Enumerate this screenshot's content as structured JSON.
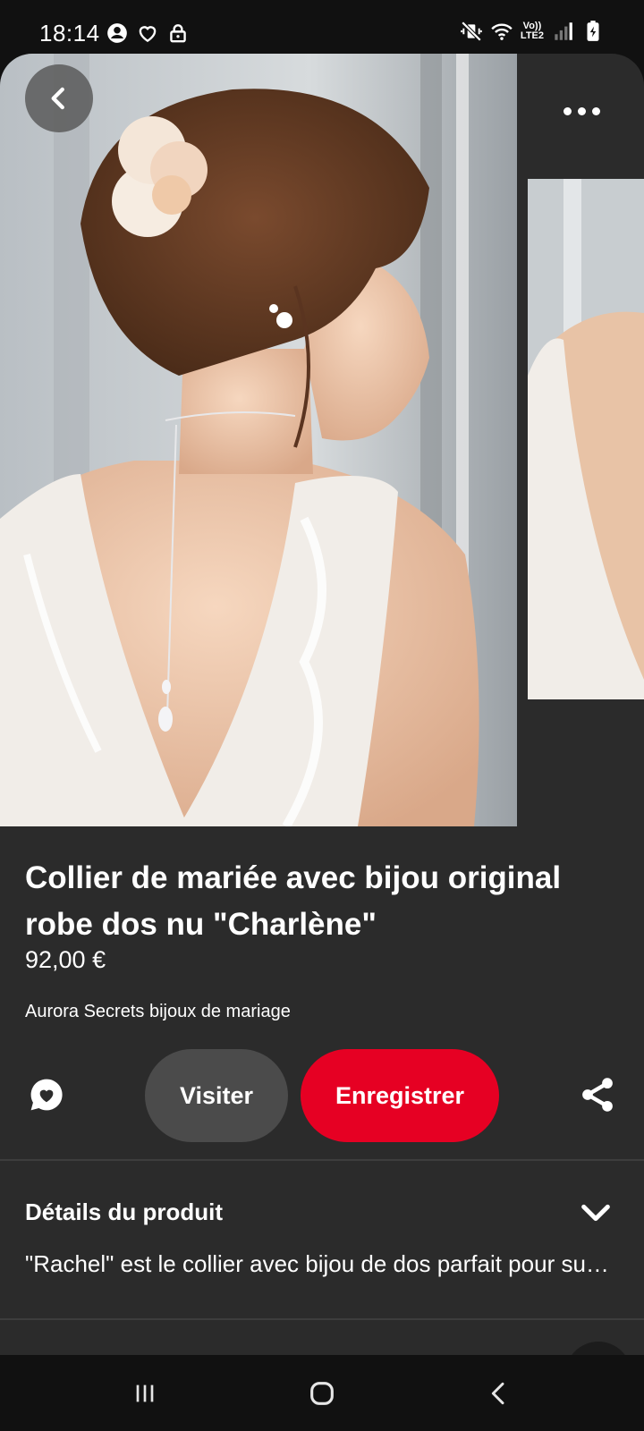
{
  "status_bar": {
    "time": "18:14",
    "left_icons": [
      "account-circle-icon",
      "heart-outline-icon",
      "lock-icon"
    ],
    "right_icons": [
      "mute-vibrate-icon",
      "wifi-icon",
      "volte-lte-icon",
      "signal-icon",
      "battery-charging-icon"
    ],
    "volte_label": "Vo))",
    "lte_label": "LTE2"
  },
  "pin": {
    "title": "Collier de mariée avec bijou original robe dos nu \"Charlène\"",
    "price": "92,00 €",
    "seller": "Aurora Secrets bijoux de mariage"
  },
  "actions": {
    "visit_label": "Visiter",
    "save_label": "Enregistrer",
    "save_color": "#e60023",
    "visit_color": "#4b4b4b"
  },
  "details": {
    "heading": "Détails du produit",
    "description": "\"Rachel\" est le collier avec bijou de dos parfait pour sublimer votre robe de mariée"
  },
  "theme": {
    "background": "#111111",
    "card": "#2b2b2b",
    "text": "#ffffff"
  }
}
